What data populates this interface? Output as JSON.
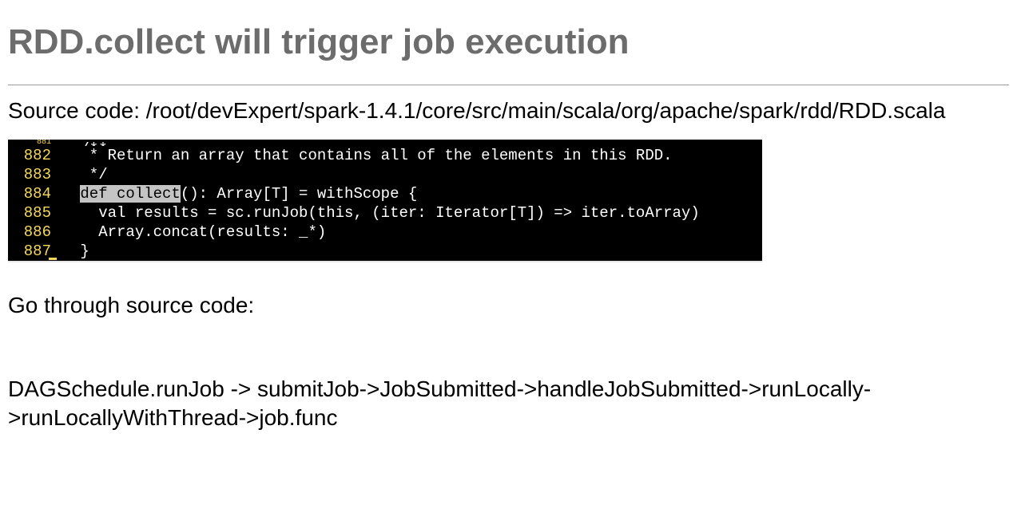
{
  "heading": "RDD.collect will trigger job execution",
  "source_path": "Source code: /root/devExpert/spark-1.4.1/core/src/main/scala/org/apache/spark/rdd/RDD.scala",
  "code": {
    "lines": [
      {
        "num": "881",
        "prefix": " /**",
        "highlight": "",
        "suffix": "",
        "tiny": true
      },
      {
        "num": "882",
        "prefix": "  * Return an array that contains all of the elements in this RDD.",
        "highlight": "",
        "suffix": ""
      },
      {
        "num": "883",
        "prefix": "  */",
        "highlight": "",
        "suffix": ""
      },
      {
        "num": "884",
        "prefix": " ",
        "highlight": "def collect",
        "suffix": "(): Array[T] = withScope {"
      },
      {
        "num": "885",
        "prefix": "   val results = sc.runJob(this, (iter: Iterator[T]) => iter.toArray)",
        "highlight": "",
        "suffix": ""
      },
      {
        "num": "886",
        "prefix": "   Array.concat(results: _*)",
        "highlight": "",
        "suffix": ""
      },
      {
        "num": "887",
        "prefix": " }",
        "highlight": "",
        "suffix": ""
      }
    ]
  },
  "go_through": "Go through source code:",
  "flow": "DAGSchedule.runJob -> submitJob->JobSubmitted->handleJobSubmitted->runLocally->runLocallyWithThread->job.func"
}
